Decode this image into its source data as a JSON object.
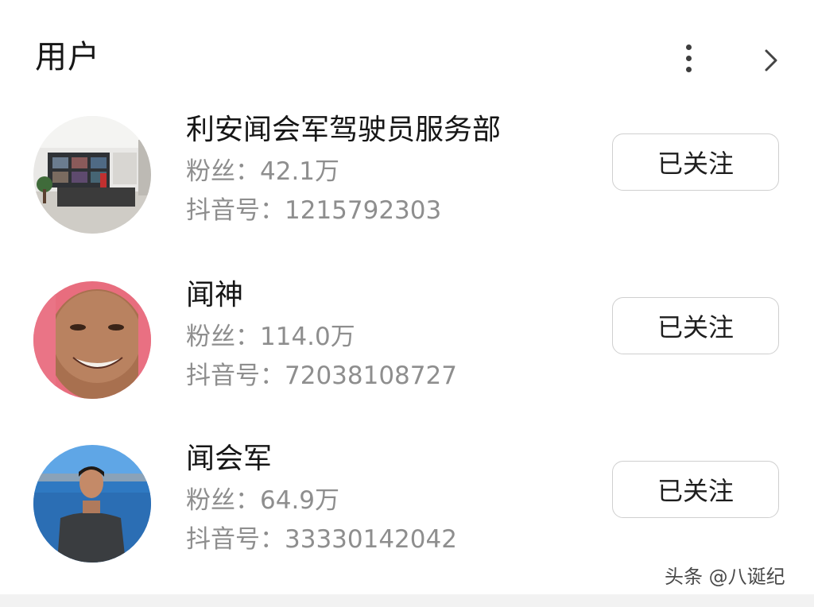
{
  "header": {
    "title": "用户",
    "more_icon": "more-vertical-icon",
    "forward_icon": "chevron-right-icon"
  },
  "users": [
    {
      "name": "利安闻会军驾驶员服务部",
      "fans": "粉丝：42.1万",
      "douyin_id": "抖音号：1215792303",
      "follow_label": "已关注"
    },
    {
      "name": "闻神",
      "fans": "粉丝：114.0万",
      "douyin_id": "抖音号：72038108727",
      "follow_label": "已关注"
    },
    {
      "name": "闻会军",
      "fans": "粉丝：64.9万",
      "douyin_id": "抖音号：33330142042",
      "follow_label": "已关注"
    }
  ],
  "watermark": "头条 @八诞纪",
  "colors": {
    "text_primary": "#161616",
    "text_secondary": "#8e8e8e",
    "button_border": "#cfcfcf"
  }
}
